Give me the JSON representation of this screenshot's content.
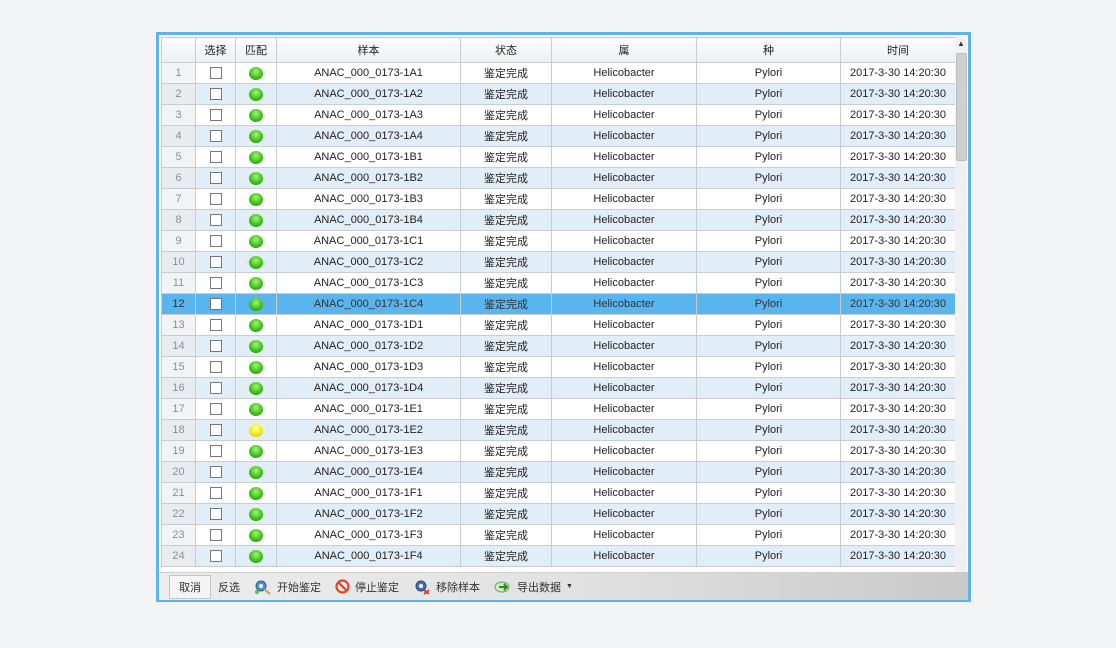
{
  "columns": [
    "",
    "选择",
    "匹配",
    "样本",
    "状态",
    "属",
    "种",
    "时间"
  ],
  "selected_row_index": 11,
  "rows": [
    {
      "num": "1",
      "sample": "ANAC_000_0173-1A1",
      "status": "鉴定完成",
      "genus": "Helicobacter",
      "species": "Pylori",
      "time": "2017-3-30 14:20:30",
      "match": "green"
    },
    {
      "num": "2",
      "sample": "ANAC_000_0173-1A2",
      "status": "鉴定完成",
      "genus": "Helicobacter",
      "species": "Pylori",
      "time": "2017-3-30 14:20:30",
      "match": "green"
    },
    {
      "num": "3",
      "sample": "ANAC_000_0173-1A3",
      "status": "鉴定完成",
      "genus": "Helicobacter",
      "species": "Pylori",
      "time": "2017-3-30 14:20:30",
      "match": "green"
    },
    {
      "num": "4",
      "sample": "ANAC_000_0173-1A4",
      "status": "鉴定完成",
      "genus": "Helicobacter",
      "species": "Pylori",
      "time": "2017-3-30 14:20:30",
      "match": "green"
    },
    {
      "num": "5",
      "sample": "ANAC_000_0173-1B1",
      "status": "鉴定完成",
      "genus": "Helicobacter",
      "species": "Pylori",
      "time": "2017-3-30 14:20:30",
      "match": "green"
    },
    {
      "num": "6",
      "sample": "ANAC_000_0173-1B2",
      "status": "鉴定完成",
      "genus": "Helicobacter",
      "species": "Pylori",
      "time": "2017-3-30 14:20:30",
      "match": "green"
    },
    {
      "num": "7",
      "sample": "ANAC_000_0173-1B3",
      "status": "鉴定完成",
      "genus": "Helicobacter",
      "species": "Pylori",
      "time": "2017-3-30 14:20:30",
      "match": "green"
    },
    {
      "num": "8",
      "sample": "ANAC_000_0173-1B4",
      "status": "鉴定完成",
      "genus": "Helicobacter",
      "species": "Pylori",
      "time": "2017-3-30 14:20:30",
      "match": "green"
    },
    {
      "num": "9",
      "sample": "ANAC_000_0173-1C1",
      "status": "鉴定完成",
      "genus": "Helicobacter",
      "species": "Pylori",
      "time": "2017-3-30 14:20:30",
      "match": "green"
    },
    {
      "num": "10",
      "sample": "ANAC_000_0173-1C2",
      "status": "鉴定完成",
      "genus": "Helicobacter",
      "species": "Pylori",
      "time": "2017-3-30 14:20:30",
      "match": "green"
    },
    {
      "num": "11",
      "sample": "ANAC_000_0173-1C3",
      "status": "鉴定完成",
      "genus": "Helicobacter",
      "species": "Pylori",
      "time": "2017-3-30 14:20:30",
      "match": "green"
    },
    {
      "num": "12",
      "sample": "ANAC_000_0173-1C4",
      "status": "鉴定完成",
      "genus": "Helicobacter",
      "species": "Pylori",
      "time": "2017-3-30 14:20:30",
      "match": "green"
    },
    {
      "num": "13",
      "sample": "ANAC_000_0173-1D1",
      "status": "鉴定完成",
      "genus": "Helicobacter",
      "species": "Pylori",
      "time": "2017-3-30 14:20:30",
      "match": "green"
    },
    {
      "num": "14",
      "sample": "ANAC_000_0173-1D2",
      "status": "鉴定完成",
      "genus": "Helicobacter",
      "species": "Pylori",
      "time": "2017-3-30 14:20:30",
      "match": "green"
    },
    {
      "num": "15",
      "sample": "ANAC_000_0173-1D3",
      "status": "鉴定完成",
      "genus": "Helicobacter",
      "species": "Pylori",
      "time": "2017-3-30 14:20:30",
      "match": "green"
    },
    {
      "num": "16",
      "sample": "ANAC_000_0173-1D4",
      "status": "鉴定完成",
      "genus": "Helicobacter",
      "species": "Pylori",
      "time": "2017-3-30 14:20:30",
      "match": "green"
    },
    {
      "num": "17",
      "sample": "ANAC_000_0173-1E1",
      "status": "鉴定完成",
      "genus": "Helicobacter",
      "species": "Pylori",
      "time": "2017-3-30 14:20:30",
      "match": "green"
    },
    {
      "num": "18",
      "sample": "ANAC_000_0173-1E2",
      "status": "鉴定完成",
      "genus": "Helicobacter",
      "species": "Pylori",
      "time": "2017-3-30 14:20:30",
      "match": "yellow"
    },
    {
      "num": "19",
      "sample": "ANAC_000_0173-1E3",
      "status": "鉴定完成",
      "genus": "Helicobacter",
      "species": "Pylori",
      "time": "2017-3-30 14:20:30",
      "match": "green"
    },
    {
      "num": "20",
      "sample": "ANAC_000_0173-1E4",
      "status": "鉴定完成",
      "genus": "Helicobacter",
      "species": "Pylori",
      "time": "2017-3-30 14:20:30",
      "match": "green"
    },
    {
      "num": "21",
      "sample": "ANAC_000_0173-1F1",
      "status": "鉴定完成",
      "genus": "Helicobacter",
      "species": "Pylori",
      "time": "2017-3-30 14:20:30",
      "match": "green"
    },
    {
      "num": "22",
      "sample": "ANAC_000_0173-1F2",
      "status": "鉴定完成",
      "genus": "Helicobacter",
      "species": "Pylori",
      "time": "2017-3-30 14:20:30",
      "match": "green"
    },
    {
      "num": "23",
      "sample": "ANAC_000_0173-1F3",
      "status": "鉴定完成",
      "genus": "Helicobacter",
      "species": "Pylori",
      "time": "2017-3-30 14:20:30",
      "match": "green"
    },
    {
      "num": "24",
      "sample": "ANAC_000_0173-1F4",
      "status": "鉴定完成",
      "genus": "Helicobacter",
      "species": "Pylori",
      "time": "2017-3-30 14:20:30",
      "match": "green"
    }
  ],
  "toolbar": {
    "cancel": "取消",
    "invert": "反选",
    "start": "开始鉴定",
    "stop": "停止鉴定",
    "remove": "移除样本",
    "export": "导出数据"
  },
  "colors": {
    "frame_border": "#5fb3e8",
    "selected_row": "#5ab4ee",
    "alt_row": "#e2eef7",
    "match_green": "#3ec21a",
    "match_yellow": "#f0ea1a"
  },
  "icons": {
    "start": "gear-run-icon",
    "stop": "no-entry-icon",
    "remove": "remove-gear-icon",
    "export": "export-arrow-icon",
    "export_menu": "caret-down-icon",
    "scroll_up": "arrow-up-icon"
  }
}
